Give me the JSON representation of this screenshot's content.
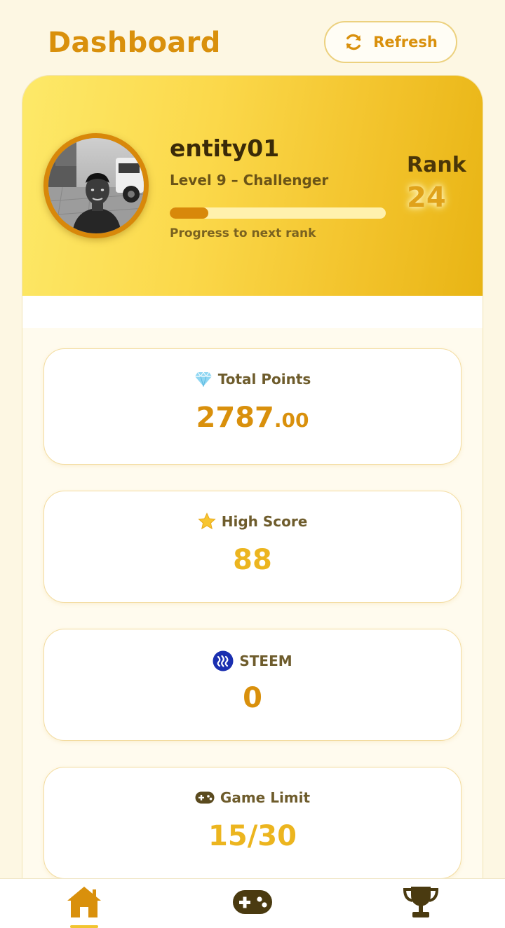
{
  "header": {
    "title": "Dashboard",
    "refresh_label": "Refresh"
  },
  "profile": {
    "username": "entity01",
    "level": "Level 9 – Challenger",
    "progress_label": "Progress to next rank",
    "progress": 0.18,
    "rank_label": "Rank",
    "rank_value": "24"
  },
  "stats": [
    {
      "icon": "gem-icon",
      "label": "Total Points",
      "value_main": "2787",
      "value_cents": ".00",
      "color": "#d9900c"
    },
    {
      "icon": "star-icon",
      "label": "High Score",
      "value": "88",
      "color": "#ecb51f"
    },
    {
      "icon": "steem-icon",
      "label": "STEEM",
      "value": "0",
      "color": "#d9900c"
    },
    {
      "icon": "gamepad-icon",
      "label": "Game Limit",
      "value": "15/30",
      "color": "#ecb51f"
    }
  ],
  "nav": {
    "items": [
      {
        "icon": "home-icon",
        "active": true
      },
      {
        "icon": "gamepad-icon",
        "active": false
      },
      {
        "icon": "trophy-icon",
        "active": false
      }
    ]
  },
  "colors": {
    "accent": "#d9900c",
    "gold": "#ecb51f",
    "background": "#fdf7e3"
  }
}
